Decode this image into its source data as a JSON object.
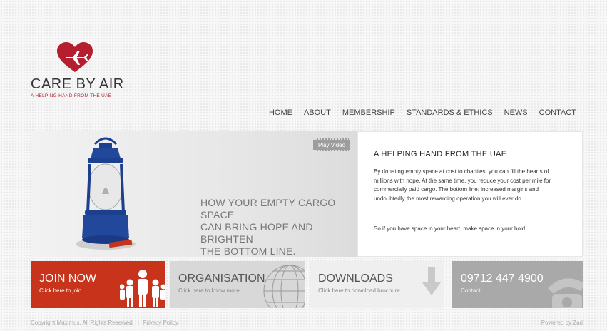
{
  "brand": {
    "name": "CARE BY AIR",
    "tagline": "A HELPING HAND FROM THE UAE",
    "heart_color": "#b41e2e"
  },
  "nav": {
    "items": [
      "HOME",
      "ABOUT",
      "MEMBERSHIP",
      "STANDARDS & ETHICS",
      "NEWS",
      "CONTACT"
    ]
  },
  "hero": {
    "headline": "HOW YOUR EMPTY CARGO SPACE\nCAN BRING HOPE AND BRIGHTEN\nTHE BOTTOM LINE.",
    "play_label": "Play Video",
    "lantern_color": "#1d3f8f"
  },
  "info": {
    "heading": "A HELPING HAND FROM THE UAE",
    "paragraph1": "By donating empty space at cost to charities, you can fill the hearts of millions with hope. At the same time, you reduce your cost per mile for commercially paid cargo. The bottom line: increased margins and undoubtedly the most rewarding operation you will ever do.",
    "paragraph2": "So if you have space in your heart, make space in your hold."
  },
  "tiles": {
    "join": {
      "title": "JOIN NOW",
      "subtitle": "Click here to join",
      "color": "#c8331c"
    },
    "organisation": {
      "title": "ORGANISATION",
      "subtitle": "Click here to know more"
    },
    "downloads": {
      "title": "DOWNLOADS",
      "subtitle": "Click here to download brochure"
    },
    "contact": {
      "title": "09712 447 4900",
      "subtitle": "Contact"
    }
  },
  "footer": {
    "copyright": "Copyright Maximus. All Rights Reserved.",
    "separator": "|",
    "privacy": "Privacy Policy",
    "powered": "Powered by Zad"
  }
}
